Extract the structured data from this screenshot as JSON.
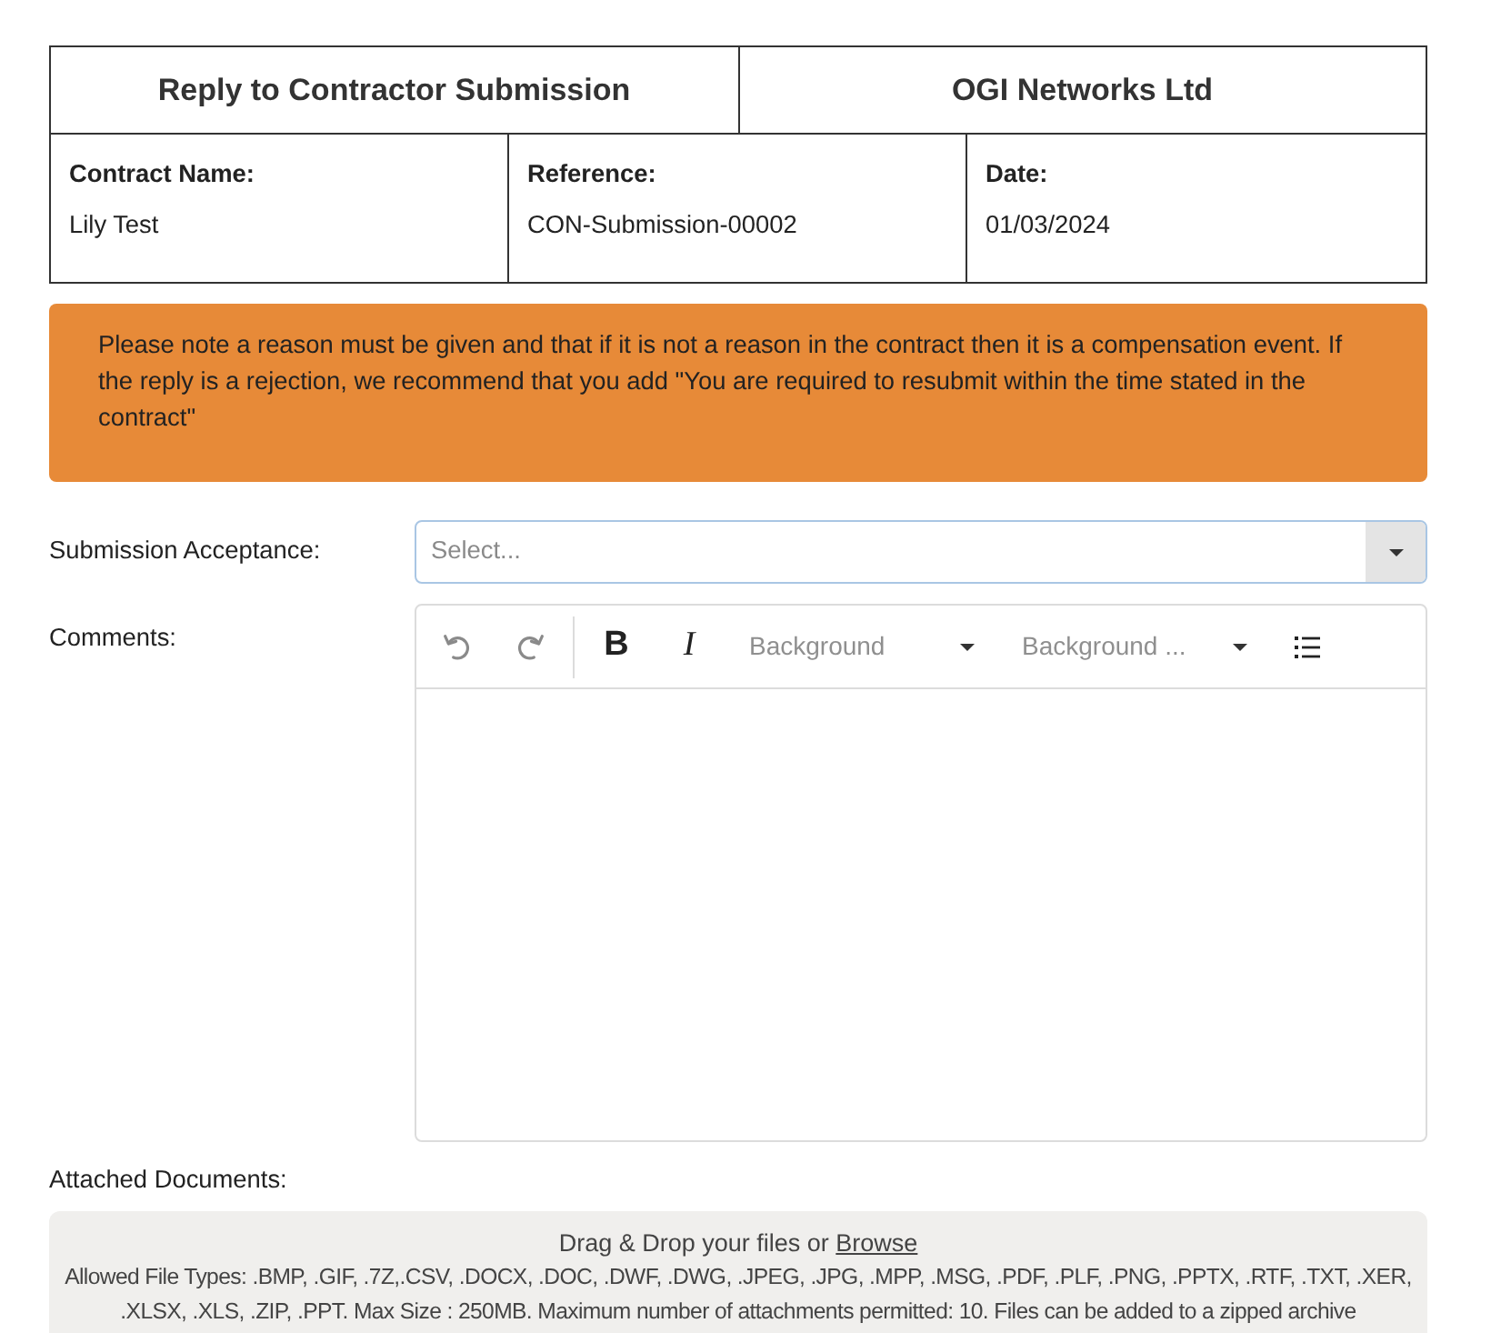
{
  "header": {
    "title": "Reply to Contractor Submission",
    "company": "OGI Networks Ltd"
  },
  "details": [
    {
      "label": "Contract Name:",
      "value": "Lily Test"
    },
    {
      "label": "Reference:",
      "value": "CON-Submission-00002"
    },
    {
      "label": "Date:",
      "value": "01/03/2024"
    }
  ],
  "notice": "Please note a reason must be given and that if it is not a reason in the contract then it is a compensation event. If the reply is a rejection, we recommend that you add \"You are required to resubmit within the time stated in the contract\"",
  "acceptance": {
    "label": "Submission Acceptance:",
    "placeholder": "Select..."
  },
  "comments": {
    "label": "Comments:",
    "toolbar_groups": [
      {
        "tools": [
          {
            "kind": "undo",
            "disabled": true
          },
          {
            "kind": "redo",
            "disabled": true
          }
        ]
      },
      {
        "tools": [
          {
            "kind": "bold",
            "label": "B",
            "disabled": false
          },
          {
            "kind": "italic",
            "label": "I",
            "disabled": false
          },
          {
            "kind": "dropdown",
            "label": "Background"
          },
          {
            "kind": "dropdown",
            "label": "Background ..."
          },
          {
            "kind": "list",
            "disabled": false
          }
        ]
      }
    ]
  },
  "attachments": {
    "label": "Attached Documents:",
    "drop_text": "Drag & Drop your files or",
    "browse_link": "Browse",
    "allowed": "Allowed File Types: .BMP, .GIF, .7Z,.CSV, .DOCX, .DOC, .DWF, .DWG, .JPEG, .JPG, .MPP, .MSG, .PDF, .PLF, .PNG, .PPTX, .RTF, .TXT, .XER, .XLSX, .XLS, .ZIP, .PPT. Max Size : 250MB. Maximum number of attachments permitted: 10. Files can be added to a zipped archive"
  }
}
